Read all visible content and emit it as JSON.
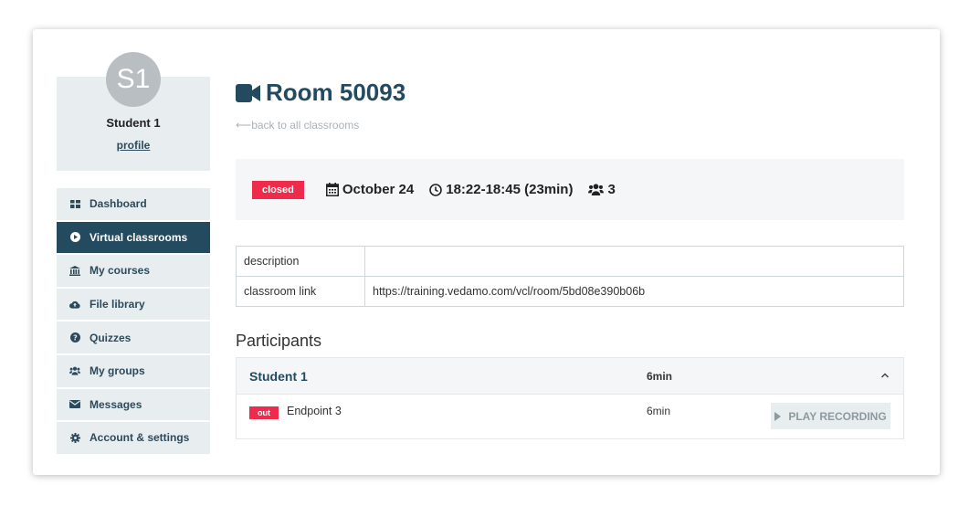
{
  "user": {
    "initials": "S1",
    "name": "Student 1",
    "profile_label": "profile"
  },
  "sidebar": {
    "items": [
      {
        "label": "Dashboard",
        "icon": "dashboard-icon"
      },
      {
        "label": "Virtual classrooms",
        "icon": "play-circle-icon",
        "active": true
      },
      {
        "label": "My courses",
        "icon": "institution-icon"
      },
      {
        "label": "File library",
        "icon": "cloud-upload-icon"
      },
      {
        "label": "Quizzes",
        "icon": "question-circle-icon"
      },
      {
        "label": "My groups",
        "icon": "users-icon"
      },
      {
        "label": "Messages",
        "icon": "envelope-icon"
      },
      {
        "label": "Account & settings",
        "icon": "gear-icon"
      }
    ]
  },
  "room": {
    "title": "Room 50093",
    "back_label": "back to all classrooms",
    "status": "closed",
    "date": "October 24",
    "time": "18:22-18:45 (23min)",
    "participants_count": "3"
  },
  "details": {
    "rows": [
      {
        "key": "description",
        "value": ""
      },
      {
        "key": "classroom link",
        "value": "https://training.vedamo.com/vcl/room/5bd08e390b06b"
      }
    ]
  },
  "participants": {
    "title": "Participants",
    "list": [
      {
        "name": "Student 1",
        "duration": "6min",
        "endpoints": [
          {
            "status": "out",
            "name": "Endpoint 3",
            "duration": "6min",
            "action_label": "PLAY RECORDING"
          }
        ]
      }
    ]
  },
  "colors": {
    "primary": "#244a5f",
    "danger": "#ef2a4a",
    "panel": "#e8eef0"
  }
}
